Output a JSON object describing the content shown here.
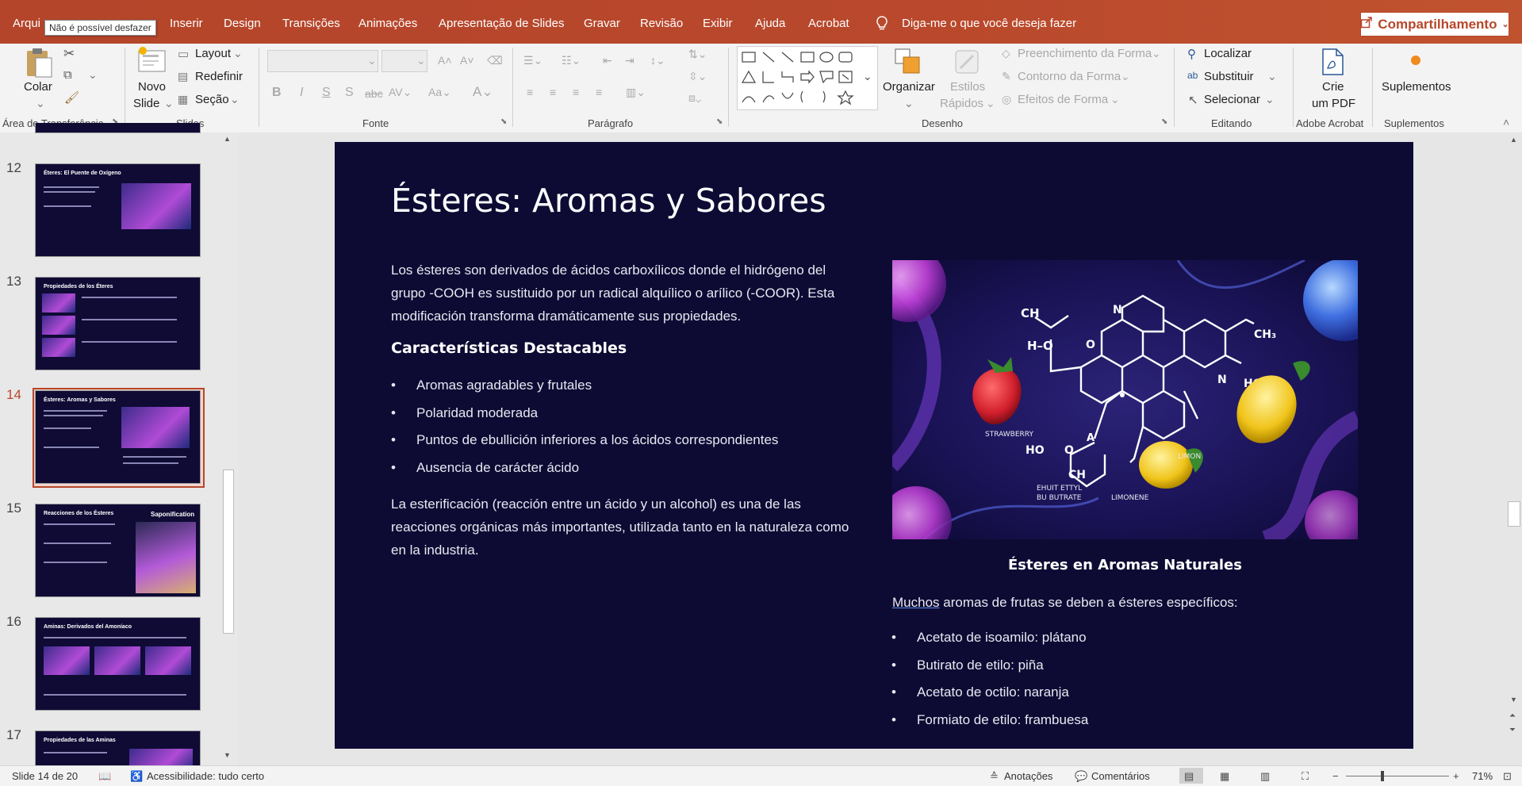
{
  "tabs": {
    "file": "Arqui",
    "insert": "Inserir",
    "design": "Design",
    "transitions": "Transições",
    "animations": "Animações",
    "slideshow": "Apresentação de Slides",
    "record": "Gravar",
    "review": "Revisão",
    "view": "Exibir",
    "help": "Ajuda",
    "acrobat": "Acrobat",
    "tell_me": "Diga-me o que você deseja fazer"
  },
  "tooltip": "Não é possível desfazer",
  "share_label": "Compartilhamento",
  "ribbon": {
    "clipboard": {
      "paste": "Colar",
      "label": "Área de Transferência"
    },
    "slides": {
      "new_slide_1": "Novo",
      "new_slide_2": "Slide",
      "layout": "Layout",
      "reset": "Redefinir",
      "section": "Seção",
      "label": "Slides"
    },
    "font": {
      "label": "Fonte"
    },
    "paragraph": {
      "label": "Parágrafo"
    },
    "drawing": {
      "arrange": "Organizar",
      "quick_styles_1": "Estilos",
      "quick_styles_2": "Rápidos",
      "shape_fill": "Preenchimento da Forma",
      "shape_outline": "Contorno da Forma",
      "shape_effects": "Efeitos de Forma",
      "label": "Desenho"
    },
    "editing": {
      "find": "Localizar",
      "replace": "Substituir",
      "select": "Selecionar",
      "label": "Editando"
    },
    "acrobat": {
      "create_pdf_1": "Crie",
      "create_pdf_2": "um PDF",
      "label": "Adobe Acrobat"
    },
    "addins": {
      "addins": "Suplementos",
      "label": "Suplementos"
    }
  },
  "thumbnails": [
    {
      "num": "12",
      "title": "Éteres: El Puente de Oxígeno"
    },
    {
      "num": "13",
      "title": "Propiedades de los Éteres"
    },
    {
      "num": "14",
      "title": "Ésteres: Aromas y Sabores"
    },
    {
      "num": "15",
      "title": "Reacciones de los Ésteres",
      "right_title": "Saponification"
    },
    {
      "num": "16",
      "title": "Aminas: Derivados del Amoníaco"
    },
    {
      "num": "17",
      "title": "Propiedades de las Aminas"
    }
  ],
  "slide": {
    "title": "Ésteres: Aromas y Sabores",
    "intro": "Los ésteres son derivados de ácidos carboxílicos donde el hidrógeno del grupo -COOH es sustituido por un radical alquílico o arílico (-COOR). Esta modificación transforma dramáticamente sus propiedades.",
    "subtitle": "Características Destacables",
    "bullets": [
      "Aromas agradables y frutales",
      "Polaridad moderada",
      "Puntos de ebullición inferiores a los ácidos correspondientes",
      "Ausencia de carácter ácido"
    ],
    "closing": "La esterificación (reacción entre un ácido y un alcohol) es una de las reacciones orgánicas más importantes, utilizada tanto en la naturaleza como en la industria.",
    "image_labels": {
      "strawberry": "STRAWBERRY",
      "limon": "LIMON",
      "limonene": "LIMONENE",
      "butyrate_1": "EHUIT ETTYL",
      "butyrate_2": "BU BUTRATE",
      "ch": "CH",
      "ho": "H–O",
      "ch3": "CH₃",
      "hc3": "HC₃",
      "n1": "N",
      "n2": "N",
      "o": "O",
      "ho2": "HO",
      "o2": "O",
      "ch2": "CH",
      "a": "A"
    },
    "right_subtitle": "Ésteres en Aromas Naturales",
    "right_intro_first": "Muchos",
    "right_intro_rest": " aromas de frutas se deben a ésteres específicos:",
    "right_bullets": [
      "Acetato de isoamilo: plátano",
      "Butirato de etilo: piña",
      "Acetato de octilo: naranja",
      "Formiato de etilo: frambuesa"
    ]
  },
  "status": {
    "slide_counter": "Slide 14 de 20",
    "accessibility": "Acessibilidade: tudo certo",
    "notes": "Anotações",
    "comments": "Comentários",
    "zoom": "71%"
  }
}
